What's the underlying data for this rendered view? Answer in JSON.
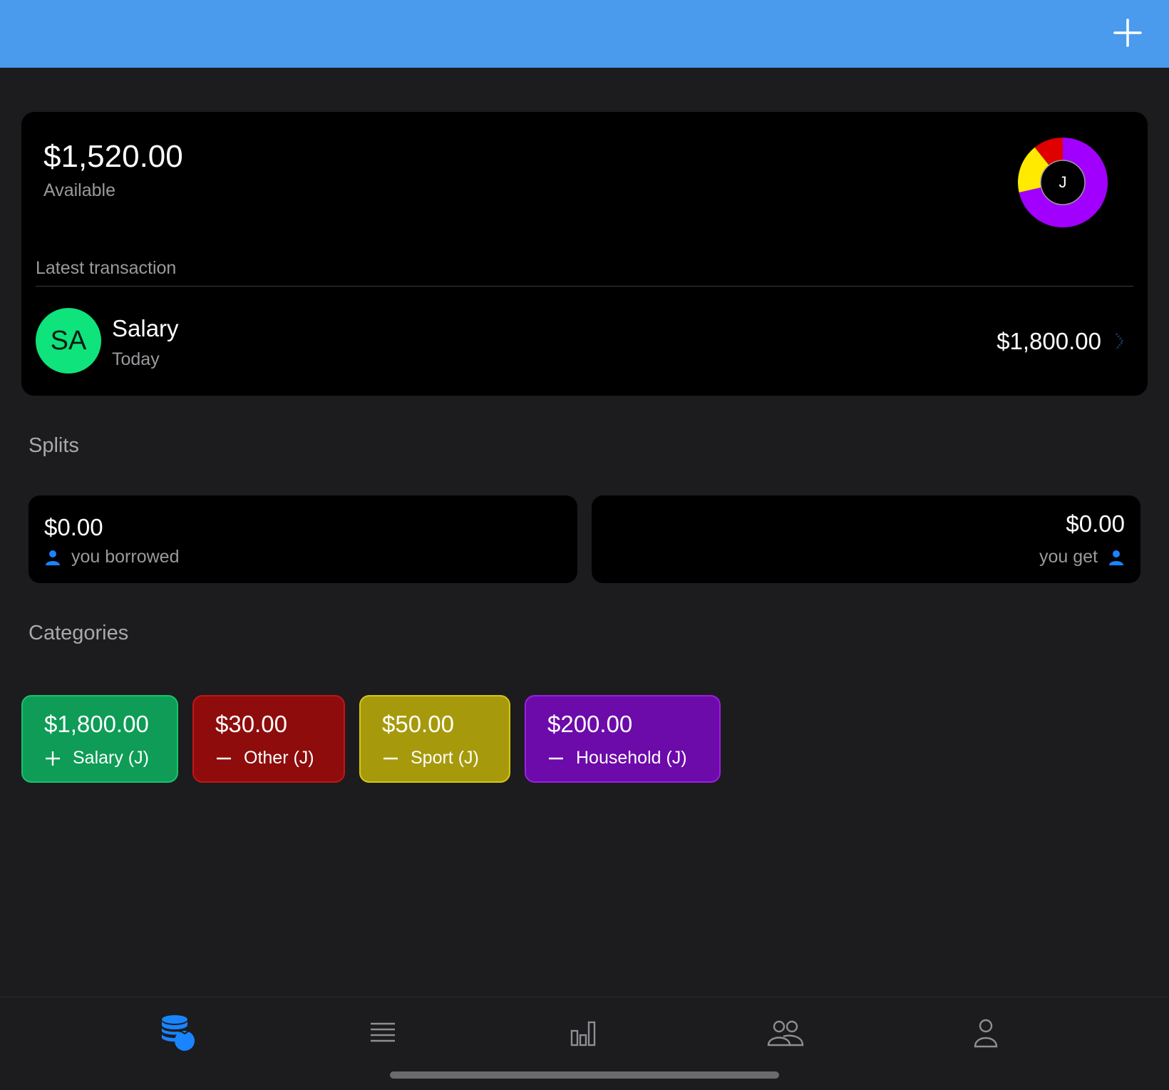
{
  "header": {
    "add_icon": "plus-icon",
    "bar_color": "#4a9aee"
  },
  "summary": {
    "balance": "$1,520.00",
    "balance_label": "Available",
    "donut_initial": "J",
    "donut_segments": [
      {
        "category": "Household",
        "amount": 200,
        "color": "#a100ff"
      },
      {
        "category": "Sport",
        "amount": 50,
        "color": "#ffea00"
      },
      {
        "category": "Other",
        "amount": 30,
        "color": "#e00000"
      }
    ],
    "latest_label": "Latest transaction",
    "latest": {
      "initials": "SA",
      "name": "Salary",
      "date": "Today",
      "amount": "$1,800.00",
      "avatar_color": "#0ee37c"
    }
  },
  "splits": {
    "title": "Splits",
    "borrowed": {
      "amount": "$0.00",
      "label": "you borrowed"
    },
    "get": {
      "amount": "$0.00",
      "label": "you get"
    }
  },
  "categories": {
    "title": "Categories",
    "items": [
      {
        "amount": "$1,800.00",
        "label": "Salary (J)",
        "sign": "plus",
        "bg": "#0e9c56",
        "border": "#18c46e"
      },
      {
        "amount": "$30.00",
        "label": "Other (J)",
        "sign": "minus",
        "bg": "#8e0c0c",
        "border": "#c21515"
      },
      {
        "amount": "$50.00",
        "label": "Sport (J)",
        "sign": "minus",
        "bg": "#a69a0c",
        "border": "#d6c814"
      },
      {
        "amount": "$200.00",
        "label": "Household (J)",
        "sign": "minus",
        "bg": "#6c0aaa",
        "border": "#9d1ee6"
      }
    ]
  },
  "tabbar": {
    "tabs": [
      {
        "name": "wallet",
        "icon": "money-stack-icon",
        "active": true
      },
      {
        "name": "transactions",
        "icon": "list-icon",
        "active": false
      },
      {
        "name": "statistics",
        "icon": "bar-chart-icon",
        "active": false
      },
      {
        "name": "groups",
        "icon": "group-icon",
        "active": false
      },
      {
        "name": "profile",
        "icon": "person-icon",
        "active": false
      }
    ],
    "active_color": "#1a84ff",
    "inactive_color": "#8e8e93"
  }
}
